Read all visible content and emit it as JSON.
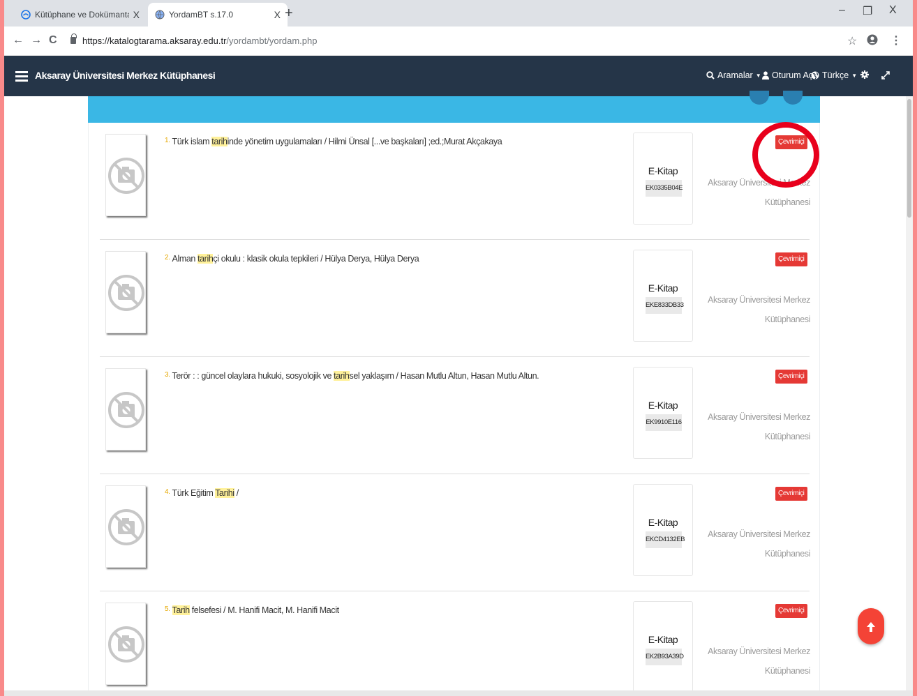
{
  "browser": {
    "tabs": [
      {
        "title": "Kütüphane ve Dokümantasyon D",
        "close": "X",
        "icon": "site-logo-icon"
      },
      {
        "title": "YordamBT s.17.0",
        "close": "X",
        "icon": "globe-icon"
      }
    ],
    "new_tab": "+",
    "window_controls": {
      "minimize": "–",
      "maximize": "❐",
      "close": "X"
    },
    "nav": {
      "back": "←",
      "forward": "→",
      "reload": "C"
    },
    "url_main": "https://katalogtarama.aksaray.edu.tr",
    "url_path": "/yordambt/yordam.php",
    "toolbar_icons": {
      "star": "☆",
      "profile": "👤",
      "menu": "⋮"
    }
  },
  "site": {
    "title": "Aksaray Üniversitesi Merkez Kütüphanesi",
    "menu": {
      "searches": "Aramalar",
      "login": "Oturum Aç",
      "language": "Türkçe"
    }
  },
  "results": [
    {
      "num": "1.",
      "pre": "Türk islam ",
      "hl": "tarih",
      "post": "inde yönetim uygulamaları / Hilmi Ünsal [...ve başkaları] ;ed.;Murat Akçakaya",
      "type": "E-Kitap",
      "code": "EK0335B04E",
      "status": "Çevrimiçi",
      "library": "Aksaray Üniversitesi Merkez Kütüphanesi"
    },
    {
      "num": "2.",
      "pre": "Alman ",
      "hl": "tarih",
      "post": "çi okulu : klasik okula tepkileri / Hülya Derya, Hülya Derya",
      "type": "E-Kitap",
      "code": "EKE833DB33",
      "status": "Çevrimiçi",
      "library": "Aksaray Üniversitesi Merkez Kütüphanesi"
    },
    {
      "num": "3.",
      "pre": "Terör : : güncel olaylara hukuki, sosyolojik ve ",
      "hl": "tarih",
      "post": "sel yaklaşım / Hasan Mutlu Altun, Hasan Mutlu Altun.",
      "type": "E-Kitap",
      "code": "EK9910E116",
      "status": "Çevrimiçi",
      "library": "Aksaray Üniversitesi Merkez Kütüphanesi"
    },
    {
      "num": "4.",
      "pre": "Türk Eğitim ",
      "hl": "Tarihi",
      "post": " /",
      "type": "E-Kitap",
      "code": "EKCD4132EB",
      "status": "Çevrimiçi",
      "library": "Aksaray Üniversitesi Merkez Kütüphanesi"
    },
    {
      "num": "5.",
      "pre": "",
      "hl": "Tarih",
      "post": " felsefesi / M. Hanifi Macit, M. Hanifi Macit",
      "type": "E-Kitap",
      "code": "EK2B93A39D",
      "status": "Çevrimiçi",
      "library": "Aksaray Üniversitesi Merkez Kütüphanesi"
    }
  ],
  "colors": {
    "navbar": "#253548",
    "banner": "#3ab7e5",
    "badge": "#e53935",
    "highlight": "#fff19a",
    "ring": "#e8001c"
  }
}
